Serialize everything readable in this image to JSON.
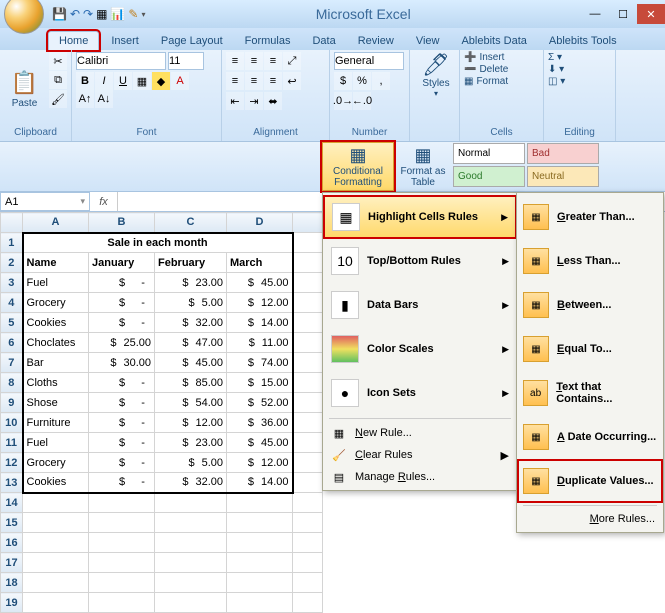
{
  "title": "Microsoft Excel",
  "tabs": [
    "Home",
    "Insert",
    "Page Layout",
    "Formulas",
    "Data",
    "Review",
    "View",
    "Ablebits Data",
    "Ablebits Tools"
  ],
  "active_tab": 0,
  "ribbon": {
    "clipboard": {
      "label": "Clipboard",
      "paste": "Paste"
    },
    "font": {
      "label": "Font",
      "name": "Calibri",
      "size": "11"
    },
    "alignment": {
      "label": "Alignment"
    },
    "number": {
      "label": "Number",
      "format": "General"
    },
    "styles": {
      "label": "Styles",
      "btn": "Styles"
    },
    "cells": {
      "label": "Cells",
      "insert": "Insert",
      "delete": "Delete",
      "format": "Format"
    },
    "editing": {
      "label": "Editing"
    }
  },
  "stylerow": {
    "cond": "Conditional Formatting",
    "table": "Format as Table",
    "normal": "Normal",
    "bad": "Bad",
    "good": "Good",
    "neutral": "Neutral"
  },
  "namebox": "A1",
  "columns": [
    "A",
    "B",
    "C",
    "D"
  ],
  "rows": [
    1,
    2,
    3,
    4,
    5,
    6,
    7,
    8,
    9,
    10,
    11,
    12,
    13,
    14,
    15,
    16,
    17,
    18,
    19
  ],
  "sheet": {
    "title": "Sale in each month",
    "headers": [
      "Name",
      "January",
      "February",
      "March"
    ],
    "data": [
      [
        "Fuel",
        "-",
        "23.00",
        "45.00"
      ],
      [
        "Grocery",
        "-",
        "5.00",
        "12.00"
      ],
      [
        "Cookies",
        "-",
        "32.00",
        "14.00"
      ],
      [
        "Choclates",
        "25.00",
        "47.00",
        "11.00"
      ],
      [
        "Bar",
        "30.00",
        "45.00",
        "74.00"
      ],
      [
        "Cloths",
        "-",
        "85.00",
        "15.00"
      ],
      [
        "Shose",
        "-",
        "54.00",
        "52.00"
      ],
      [
        "Furniture",
        "-",
        "12.00",
        "36.00"
      ],
      [
        "Fuel",
        "-",
        "23.00",
        "45.00"
      ],
      [
        "Grocery",
        "-",
        "5.00",
        "12.00"
      ],
      [
        "Cookies",
        "-",
        "32.00",
        "14.00"
      ]
    ]
  },
  "cfmenu": {
    "highlight": "Highlight Cells Rules",
    "topbottom": "Top/Bottom Rules",
    "databars": "Data Bars",
    "colorscales": "Color Scales",
    "iconsets": "Icon Sets",
    "newrule": "New Rule...",
    "clearrules": "Clear Rules",
    "managerules": "Manage Rules..."
  },
  "submenu": {
    "greater": "Greater Than...",
    "less": "Less Than...",
    "between": "Between...",
    "equal": "Equal To...",
    "text": "Text that Contains...",
    "date": "A Date Occurring...",
    "dup": "Duplicate Values...",
    "more": "More Rules..."
  }
}
